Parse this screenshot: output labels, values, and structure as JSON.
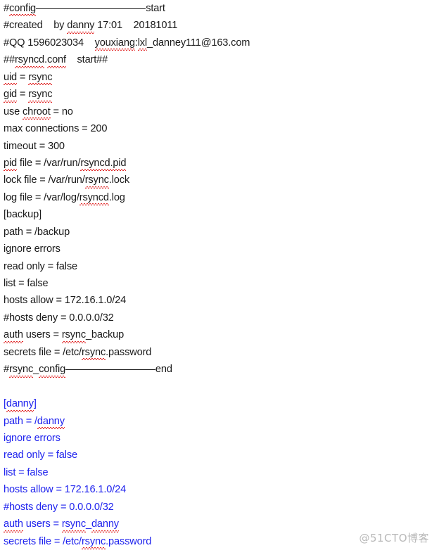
{
  "document": {
    "type": "text-document",
    "background_color": "#ffffff",
    "body_text_color": "#1a1a1a",
    "highlight_text_color": "#1f23ee",
    "spellcheck_underline_color": "#e02020",
    "title": "rsyncd.conf configuration",
    "lines": [
      {
        "id": "l01",
        "text": "#config______________________start",
        "color": "black",
        "misspelled": [
          "config"
        ]
      },
      {
        "id": "l02",
        "text": "#created    by danny 17:01    20181011",
        "color": "black",
        "misspelled": [
          "danny"
        ]
      },
      {
        "id": "l03",
        "text": "#QQ 1596023034    youxiang:lxl_danney111@163.com",
        "color": "black",
        "misspelled": [
          "youxiang",
          "lxl"
        ]
      },
      {
        "id": "l04",
        "text": "##rsyncd.conf    start##",
        "color": "black",
        "misspelled": [
          "rsyncd",
          "conf"
        ]
      },
      {
        "id": "l05",
        "text": "uid = rsync",
        "color": "black",
        "misspelled": [
          "uid",
          "rsync"
        ]
      },
      {
        "id": "l06",
        "text": "gid = rsync",
        "color": "black",
        "misspelled": [
          "gid",
          "rsync"
        ]
      },
      {
        "id": "l07",
        "text": "use chroot = no",
        "color": "black",
        "misspelled": [
          "chroot"
        ]
      },
      {
        "id": "l08",
        "text": "max connections = 200",
        "color": "black",
        "misspelled": []
      },
      {
        "id": "l09",
        "text": "timeout = 300",
        "color": "black",
        "misspelled": []
      },
      {
        "id": "l10",
        "text": "pid file = /var/run/rsyncd.pid",
        "color": "black",
        "misspelled": [
          "pid",
          "rsyncd.pid"
        ]
      },
      {
        "id": "l11",
        "text": "lock file = /var/run/rsync.lock",
        "color": "black",
        "misspelled": [
          "rsync"
        ]
      },
      {
        "id": "l12",
        "text": "log file = /var/log/rsyncd.log",
        "color": "black",
        "misspelled": [
          "rsyncd"
        ]
      },
      {
        "id": "l13",
        "text": "[backup]",
        "color": "black",
        "misspelled": []
      },
      {
        "id": "l14",
        "text": "path = /backup",
        "color": "black",
        "misspelled": []
      },
      {
        "id": "l15",
        "text": "ignore errors",
        "color": "black",
        "misspelled": []
      },
      {
        "id": "l16",
        "text": "read only = false",
        "color": "black",
        "misspelled": []
      },
      {
        "id": "l17",
        "text": "list = false",
        "color": "black",
        "misspelled": []
      },
      {
        "id": "l18",
        "text": "hosts allow = 172.16.1.0/24",
        "color": "black",
        "misspelled": []
      },
      {
        "id": "l19",
        "text": "#hosts deny = 0.0.0.0/32",
        "color": "black",
        "misspelled": []
      },
      {
        "id": "l20",
        "text": "auth users = rsync_backup",
        "color": "black",
        "misspelled": [
          "auth",
          "rsync"
        ]
      },
      {
        "id": "l21",
        "text": "secrets file = /etc/rsync.password",
        "color": "black",
        "misspelled": [
          "rsync"
        ]
      },
      {
        "id": "l22",
        "text": "#rsync_config__________________end",
        "color": "black",
        "misspelled": [
          "rsync",
          "config"
        ]
      },
      {
        "id": "l23",
        "text": "",
        "color": "black",
        "misspelled": []
      },
      {
        "id": "l24",
        "text": "[danny]",
        "color": "blue",
        "misspelled": [
          "danny"
        ]
      },
      {
        "id": "l25",
        "text": "path = /danny",
        "color": "blue",
        "misspelled": [
          "danny"
        ]
      },
      {
        "id": "l26",
        "text": "ignore errors",
        "color": "blue",
        "misspelled": []
      },
      {
        "id": "l27",
        "text": "read only = false",
        "color": "blue",
        "misspelled": []
      },
      {
        "id": "l28",
        "text": "list = false",
        "color": "blue",
        "misspelled": []
      },
      {
        "id": "l29",
        "text": "hosts allow = 172.16.1.0/24",
        "color": "blue",
        "misspelled": []
      },
      {
        "id": "l30",
        "text": "#hosts deny = 0.0.0.0/32",
        "color": "blue",
        "misspelled": []
      },
      {
        "id": "l31",
        "text": "auth users = rsync_danny",
        "color": "blue",
        "misspelled": [
          "auth",
          "rsync",
          "danny"
        ]
      },
      {
        "id": "l32",
        "text": "secrets file = /etc/rsync.password",
        "color": "blue",
        "misspelled": [
          "rsync"
        ]
      }
    ]
  },
  "watermark": {
    "text": "@51CTO博客",
    "color": "#b9b9b9"
  }
}
